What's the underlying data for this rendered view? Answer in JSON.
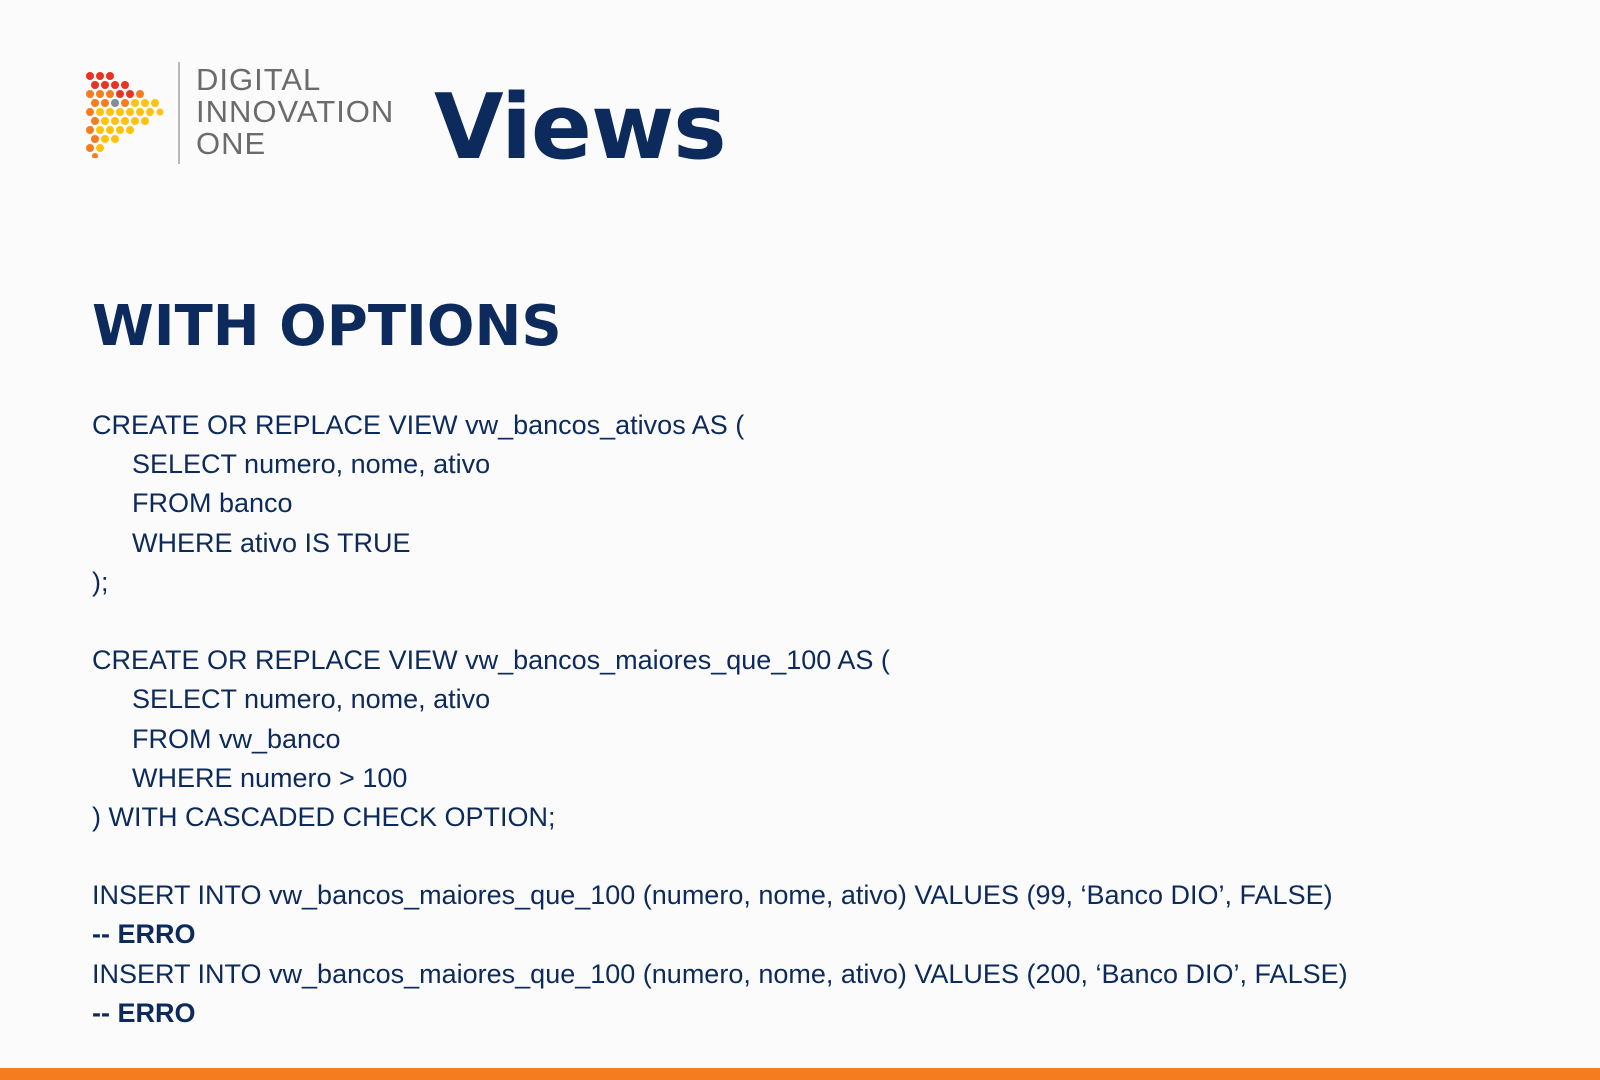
{
  "logo": {
    "line1": "DIGITAL",
    "line2": "INNOVATION",
    "line3": "ONE",
    "colors": [
      "#e63323",
      "#f57c1f",
      "#ffc20e",
      "#7f8c9a"
    ]
  },
  "title": "Views",
  "section_title": "WITH OPTIONS",
  "code": {
    "block1": {
      "line1": "CREATE OR REPLACE VIEW vw_bancos_ativos AS (",
      "line2": "SELECT numero, nome, ativo",
      "line3": "FROM banco",
      "line4": "WHERE ativo IS TRUE",
      "line5": ");"
    },
    "block2": {
      "line1": "CREATE OR REPLACE VIEW vw_bancos_maiores_que_100 AS (",
      "line2": "SELECT numero, nome, ativo",
      "line3": "FROM vw_banco",
      "line4": "WHERE numero > 100",
      "line5": ") WITH CASCADED CHECK OPTION;"
    },
    "block3": {
      "insert1": "INSERT INTO vw_bancos_maiores_que_100 (numero, nome, ativo) VALUES (99, ‘Banco DIO’, FALSE)",
      "comment1": "-- ERRO",
      "insert2": "INSERT INTO vw_bancos_maiores_que_100 (numero, nome, ativo) VALUES (200, ‘Banco DIO’, FALSE)",
      "comment2": "-- ERRO"
    }
  },
  "colors": {
    "title": "#0d2a5c",
    "accent_bar": "#f57c1f",
    "logo_text": "#6b6b6b"
  }
}
